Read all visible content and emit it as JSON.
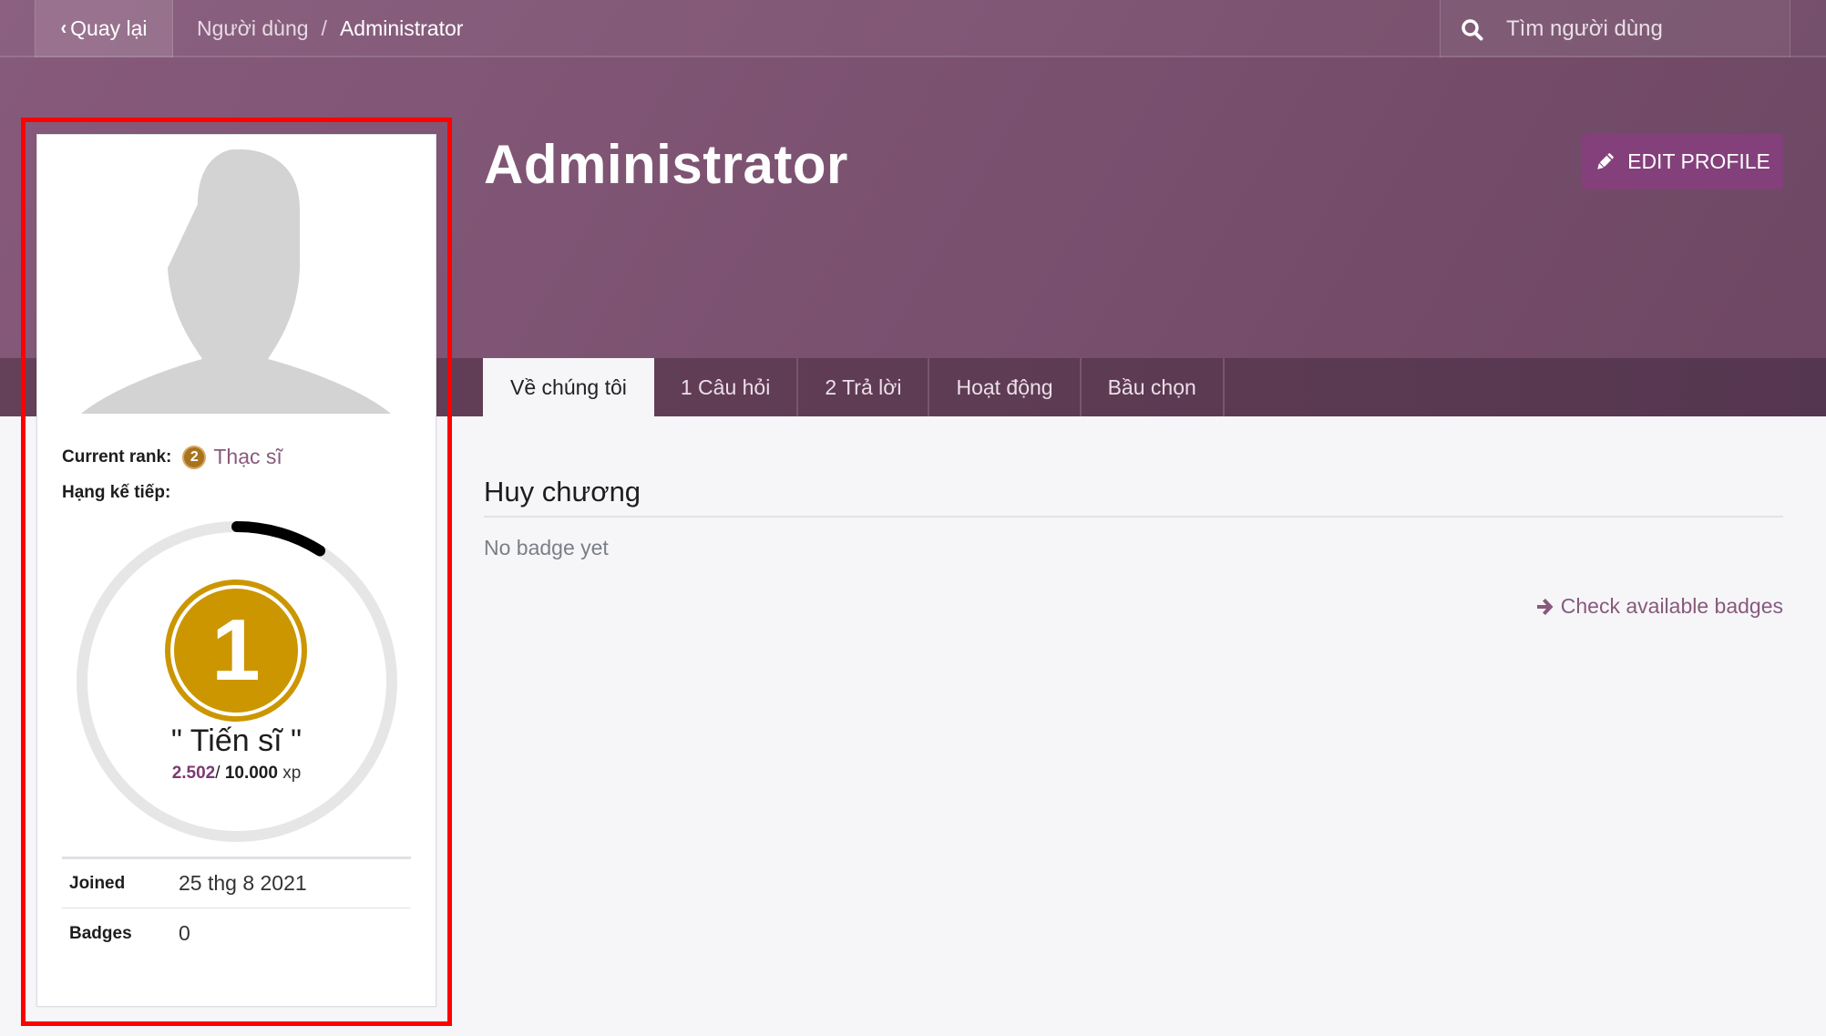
{
  "navbar": {
    "back_label": "Quay lại",
    "breadcrumb": [
      "Người dùng",
      "Administrator"
    ],
    "breadcrumb_separator": "/",
    "search_placeholder": "Tìm người dùng"
  },
  "header": {
    "title": "Administrator",
    "edit_button_label": "EDIT PROFILE"
  },
  "tabs": [
    {
      "label": "Về chúng tôi",
      "active": true
    },
    {
      "label": "1 Câu hỏi",
      "active": false
    },
    {
      "label": "2 Trả lời",
      "active": false
    },
    {
      "label": "Hoạt động",
      "active": false
    },
    {
      "label": "Bầu chọn",
      "active": false
    }
  ],
  "profile_card": {
    "current_rank_label": "Current rank:",
    "current_rank_number": "2",
    "current_rank_name": "Thạc sĩ",
    "next_rank_label": "Hạng kế tiếp:",
    "next_rank_number": "1",
    "next_rank_name": "\" Tiến sĩ \"",
    "xp_current": "2.502",
    "xp_separator": "/ ",
    "xp_total": "10.000",
    "xp_unit": "xp",
    "progress_fraction": 0.09,
    "info": [
      {
        "key": "Joined",
        "value": "25 thg 8 2021"
      },
      {
        "key": "Badges",
        "value": "0"
      }
    ]
  },
  "badges_section": {
    "title": "Huy chương",
    "empty_text": "No badge yet",
    "link_label": "Check available badges"
  },
  "colors": {
    "brand": "#875a7b",
    "button": "#83407b",
    "rank_gold": "#cc9600",
    "rank_bronze": "#a8731e",
    "highlight": "#ff0000"
  }
}
